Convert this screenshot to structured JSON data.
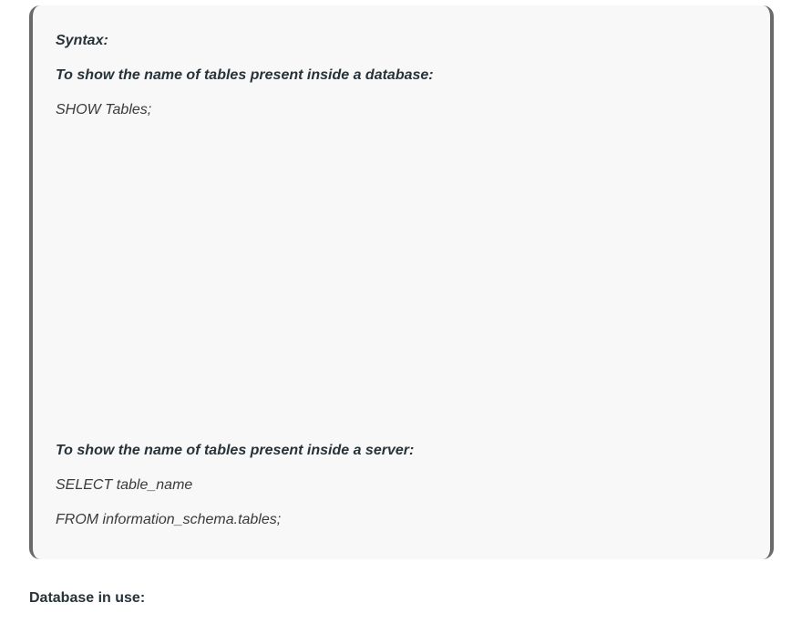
{
  "syntax_box": {
    "label": "Syntax:",
    "database_heading": "To show the name of tables present inside a database:",
    "database_query": "SHOW Tables;",
    "server_heading": "To show the name of tables present inside a server:",
    "server_query_line1": "SELECT table_name",
    "server_query_line2": "FROM information_schema.tables;"
  },
  "section": {
    "database_in_use": "Database in use:"
  }
}
